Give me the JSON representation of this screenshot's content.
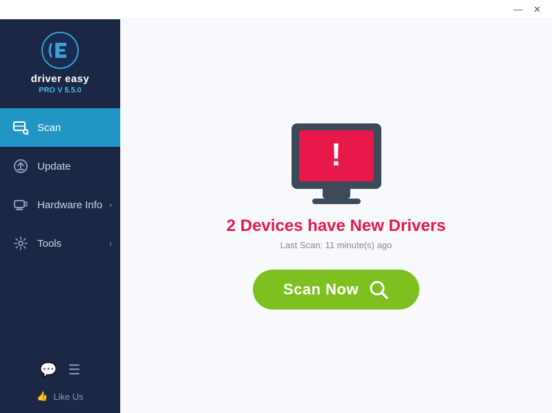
{
  "titlebar": {
    "minimize_label": "—",
    "close_label": "✕"
  },
  "sidebar": {
    "logo_text": "driver easy",
    "version": "PRO V 5.5.0",
    "items": [
      {
        "id": "scan",
        "label": "Scan",
        "active": true,
        "has_arrow": false
      },
      {
        "id": "update",
        "label": "Update",
        "active": false,
        "has_arrow": false
      },
      {
        "id": "hardware-info",
        "label": "Hardware Info",
        "active": false,
        "has_arrow": true
      },
      {
        "id": "tools",
        "label": "Tools",
        "active": false,
        "has_arrow": true
      }
    ],
    "like_us_label": "Like Us"
  },
  "main": {
    "alert_title": "2 Devices have New Drivers",
    "last_scan_label": "Last Scan: 11 minute(s) ago",
    "scan_button_label": "Scan Now"
  }
}
